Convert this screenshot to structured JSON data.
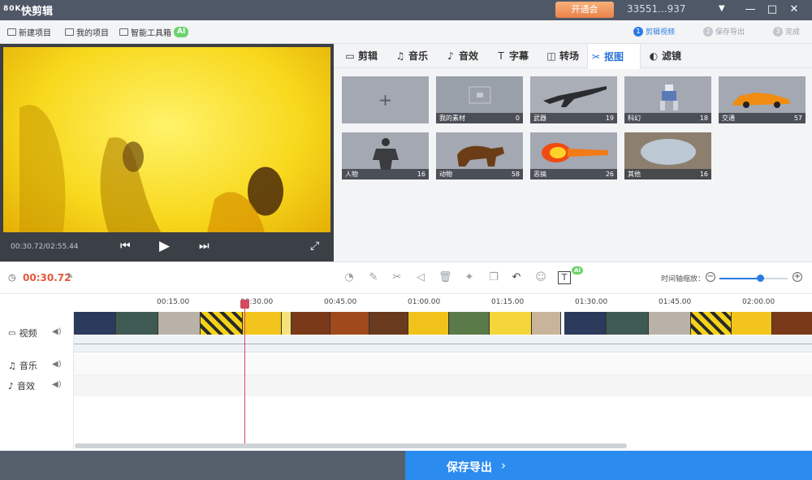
{
  "app": {
    "logo": "80K",
    "title": "快剪辑"
  },
  "titlebar": {
    "vip_label": "开通会",
    "user": "33551...937",
    "dropdown": "▼",
    "minimize": "—",
    "maximize": "□",
    "close": "✕"
  },
  "toolbar": {
    "new_project": "新建项目",
    "my_projects": "我的项目",
    "smart_toolbox": "智能工具箱",
    "ai_badge": "AI",
    "steps": [
      {
        "num": "1",
        "label": "剪辑视频"
      },
      {
        "num": "2",
        "label": "保存导出"
      },
      {
        "num": "3",
        "label": "完成"
      }
    ]
  },
  "player": {
    "time": "00:30.72/02:55.44",
    "prev": "⏮",
    "play": "▶",
    "next": "⏭",
    "fullscreen": "⤢"
  },
  "tabs": [
    {
      "icon": "▭",
      "label": "剪辑"
    },
    {
      "icon": "♫",
      "label": "音乐"
    },
    {
      "icon": "♪",
      "label": "音效"
    },
    {
      "icon": "T",
      "label": "字幕"
    },
    {
      "icon": "◫",
      "label": "转场"
    },
    {
      "icon": "✂",
      "label": "抠图"
    },
    {
      "icon": "◐",
      "label": "滤镜"
    }
  ],
  "active_tab": "抠图",
  "library": {
    "add_symbol": "+",
    "tiles": [
      {
        "name": "我的素材",
        "count": "0"
      },
      {
        "name": "武器",
        "count": "19"
      },
      {
        "name": "科幻",
        "count": "18"
      },
      {
        "name": "交通",
        "count": "57"
      },
      {
        "name": "人物",
        "count": "16"
      },
      {
        "name": "动物",
        "count": "58"
      },
      {
        "name": "恶搞",
        "count": "26"
      },
      {
        "name": "其他",
        "count": "16"
      }
    ]
  },
  "timeline": {
    "current_time": "00:30.72",
    "zoom_label": "时间轴缩放：",
    "zoom_level": 0.6,
    "zoom_minus": "−",
    "zoom_plus": "+",
    "ai_badge": "AI",
    "ruler": [
      "00:15.00",
      "00:30.00",
      "00:45.00",
      "01:00.00",
      "01:15.00",
      "01:30.00",
      "01:45.00",
      "02:00.00"
    ],
    "tracks": {
      "video": "视频",
      "music": "音乐",
      "sfx": "音效"
    }
  },
  "export": {
    "label": "保存导出",
    "chevron": "›"
  },
  "colors": {
    "accent": "#2a7be4",
    "time_red": "#e4573c",
    "playhead": "#d24b60",
    "titlebar": "#4f5867"
  }
}
